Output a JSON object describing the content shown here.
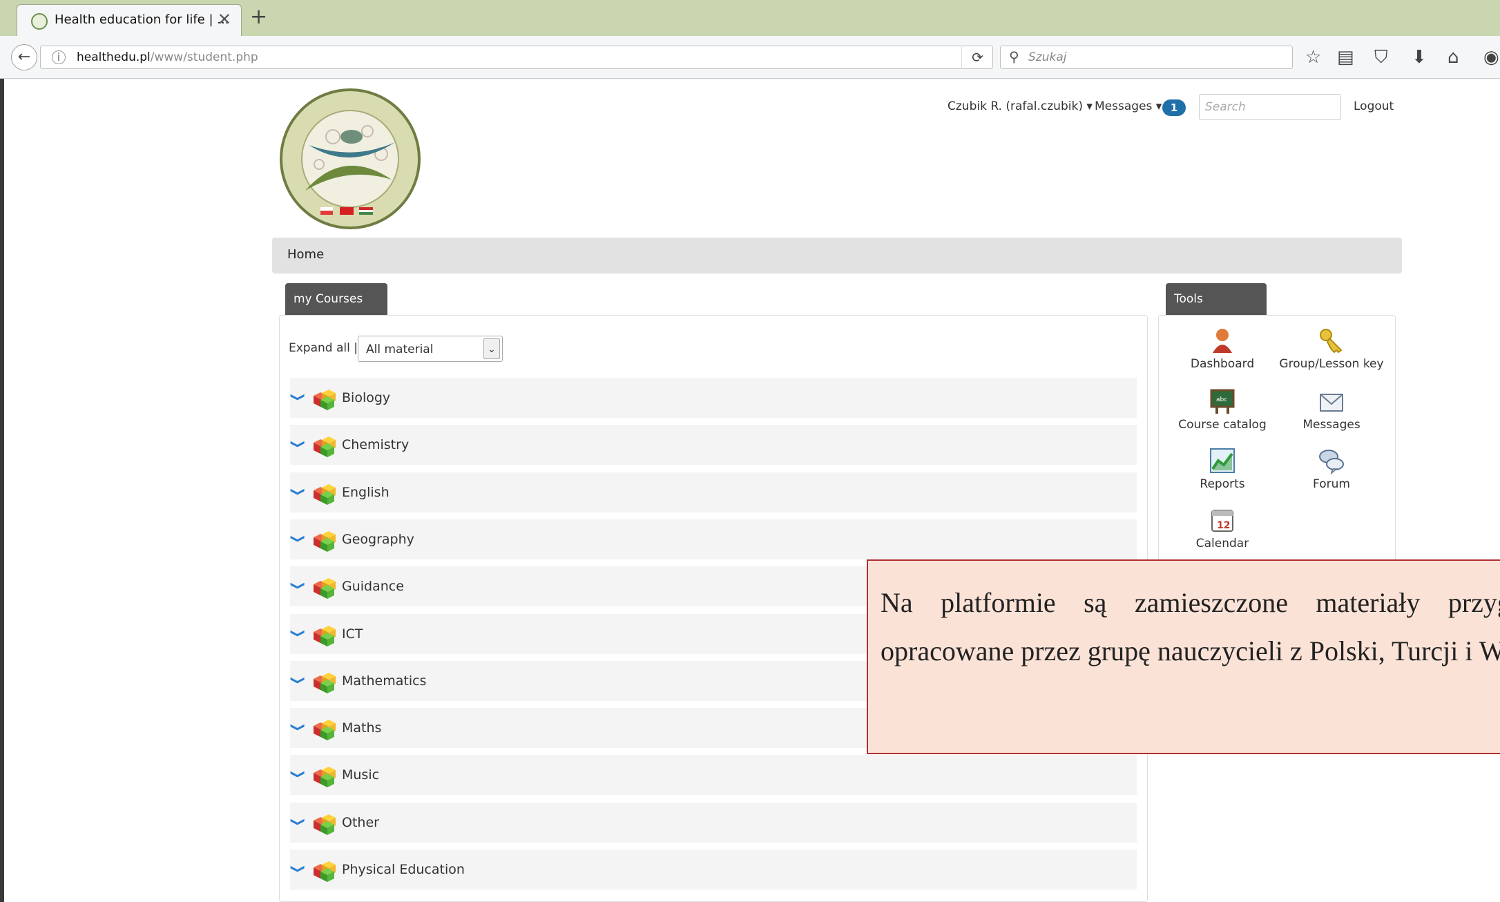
{
  "browser": {
    "tab_title": "Health education for life | ...",
    "url_domain": "healthedu.pl",
    "url_path": "/www/student.php",
    "search_placeholder": "Szukaj"
  },
  "header": {
    "user": "Czubik R. (rafal.czubik)",
    "messages_label": "Messages",
    "messages_count": "1",
    "search_placeholder": "Search",
    "logout": "Logout"
  },
  "breadcrumb": "Home",
  "courses": {
    "tab": "my Courses",
    "expand_all": "Expand all",
    "separator": "|",
    "filter_value": "All material",
    "items": [
      "Biology",
      "Chemistry",
      "English",
      "Geography",
      "Guidance",
      "ICT",
      "Mathematics",
      "Maths",
      "Music",
      "Other",
      "Physical Education"
    ]
  },
  "tools": {
    "tab": "Tools",
    "items": [
      "Dashboard",
      "Group/Lesson key",
      "Course catalog",
      "Messages",
      "Reports",
      "Forum",
      "Calendar"
    ]
  },
  "callout": {
    "text": "Na platformie są zamieszczone materiały przygotowane i opracowane przez grupę nauczycieli z Polski, Turcji i Węgier."
  }
}
